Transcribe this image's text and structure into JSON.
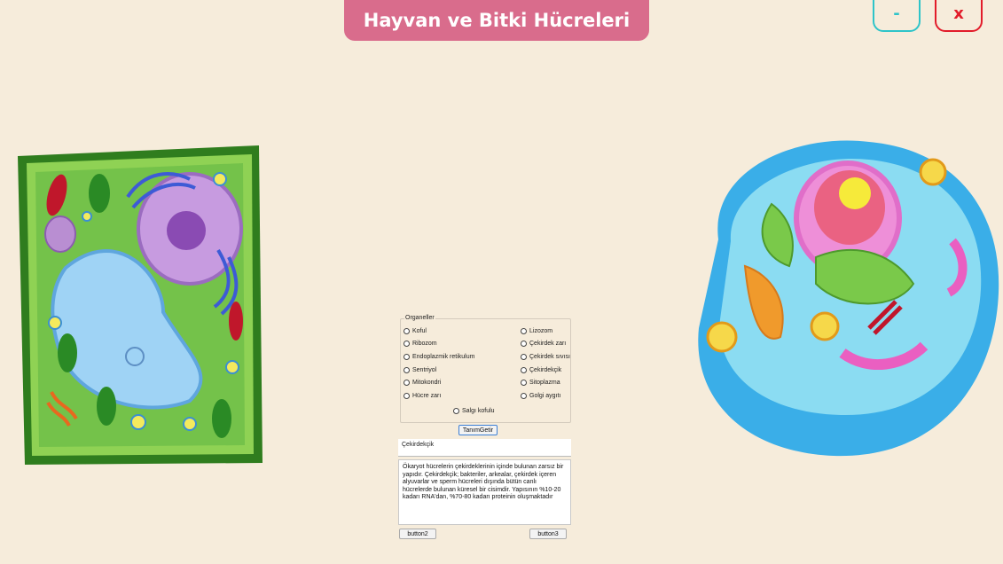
{
  "window": {
    "title": "Hayvan ve Bitki Hücreleri",
    "minimize_label": "-",
    "close_label": "x"
  },
  "organelles": {
    "group_label": "Organeller",
    "left_options": [
      "Koful",
      "Ribozom",
      "Endoplazmik retikulum",
      "Sentriyol",
      "Mitokondri",
      "Hücre zarı"
    ],
    "right_options": [
      "Lizozom",
      "Çekirdek zarı",
      "Çekirdek sıvısı",
      "Çekirdekçik",
      "Sitoplazma",
      "Golgi aygıtı"
    ],
    "center_option": "Salgı kofulu"
  },
  "buttons": {
    "get_definition": "TanımGetir",
    "button2": "button2",
    "button3": "button3"
  },
  "selected_organelle": "Çekirdekçik",
  "definition_text": "Ökaryot hücrelerin çekirdeklerinin içinde bulunan zarsız bir yapıdır. Çekirdekçik; bakteriler, arkealar, çekirdek içeren alyuvarlar ve sperm hücreleri dışında bütün canlı hücrelerde bulunan küresel bir cisimdir. Yapısının %10-20 kadarı RNA'dan, %70-80 kadarı proteinin oluşmaktadır",
  "colors": {
    "background": "#f6ecdb",
    "title_bar": "#d96c8c",
    "minimize": "#2ec4c9",
    "close": "#e21c2a"
  }
}
